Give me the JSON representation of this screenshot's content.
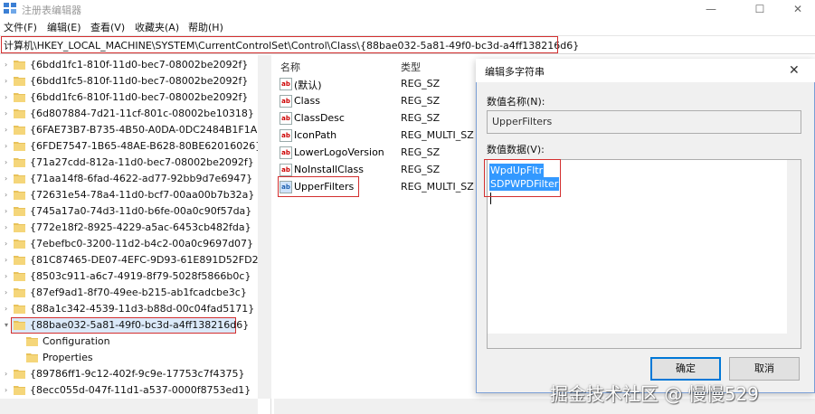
{
  "window": {
    "title": "注册表编辑器",
    "min": "—",
    "max": "☐",
    "close": "✕"
  },
  "menu": [
    "文件(F)",
    "编辑(E)",
    "查看(V)",
    "收藏夹(A)",
    "帮助(H)"
  ],
  "address": "计算机\\HKEY_LOCAL_MACHINE\\SYSTEM\\CurrentControlSet\\Control\\Class\\{88bae032-5a81-49f0-bc3d-a4ff138216d6}",
  "tree": {
    "items": [
      "{6bdd1fc1-810f-11d0-bec7-08002be2092f}",
      "{6bdd1fc5-810f-11d0-bec7-08002be2092f}",
      "{6bdd1fc6-810f-11d0-bec7-08002be2092f}",
      "{6d807884-7d21-11cf-801c-08002be10318}",
      "{6FAE73B7-B735-4B50-A0DA-0DC2484B1F1A}",
      "{6FDE7547-1B65-48AE-B628-80BE62016026}",
      "{71a27cdd-812a-11d0-bec7-08002be2092f}",
      "{71aa14f8-6fad-4622-ad77-92bb9d7e6947}",
      "{72631e54-78a4-11d0-bcf7-00aa00b7b32a}",
      "{745a17a0-74d3-11d0-b6fe-00a0c90f57da}",
      "{772e18f2-8925-4229-a5ac-6453cb482fda}",
      "{7ebefbc0-3200-11d2-b4c2-00a0c9697d07}",
      "{81C87465-DE07-4EFC-9D93-61E891D52FD2}",
      "{8503c911-a6c7-4919-8f79-5028f5866b0c}",
      "{87ef9ad1-8f70-49ee-b215-ab1fcadcbe3c}",
      "{88a1c342-4539-11d3-b88d-00c04fad5171}",
      "{88bae032-5a81-49f0-bc3d-a4ff138216d6}",
      "{89786ff1-9c12-402f-9c9e-17753c7f4375}",
      "{8ecc055d-047f-11d1-a537-0000f8753ed1}"
    ],
    "children": [
      "Configuration",
      "Properties"
    ]
  },
  "list": {
    "headers": {
      "name": "名称",
      "type": "类型"
    },
    "rows": [
      {
        "name": "(默认)",
        "type": "REG_SZ"
      },
      {
        "name": "Class",
        "type": "REG_SZ"
      },
      {
        "name": "ClassDesc",
        "type": "REG_SZ"
      },
      {
        "name": "IconPath",
        "type": "REG_MULTI_SZ"
      },
      {
        "name": "LowerLogoVersion",
        "type": "REG_SZ"
      },
      {
        "name": "NoInstallClass",
        "type": "REG_SZ"
      },
      {
        "name": "UpperFilters",
        "type": "REG_MULTI_SZ"
      }
    ]
  },
  "dialog": {
    "title": "编辑多字符串",
    "close": "✕",
    "name_label": "数值名称(N):",
    "name_value": "UpperFilters",
    "data_label": "数值数据(V):",
    "data_lines": [
      "WpdUpFltr",
      "SDPWPDFilter"
    ],
    "ok": "确定",
    "cancel": "取消"
  },
  "watermark": "掘金技术社区 @ 慢慢529"
}
